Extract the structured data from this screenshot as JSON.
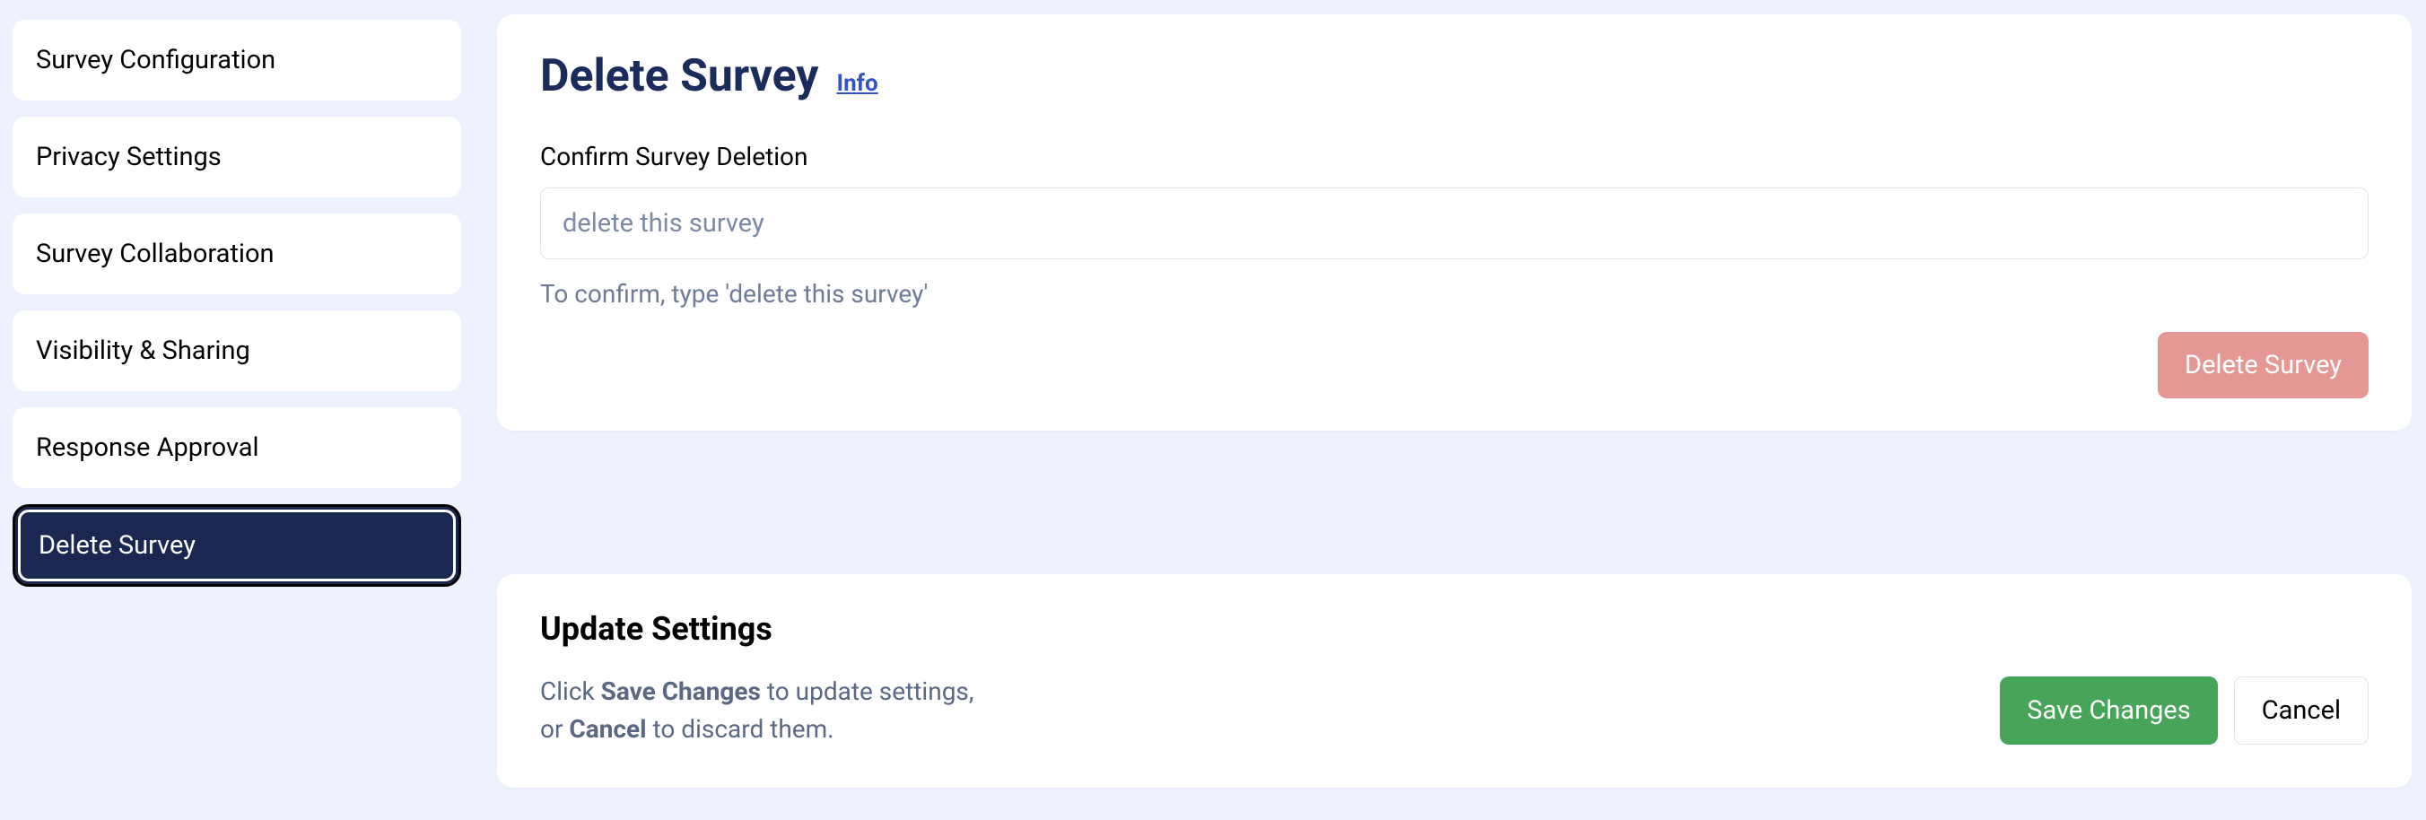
{
  "sidebar": {
    "items": [
      {
        "label": "Survey Configuration",
        "active": false
      },
      {
        "label": "Privacy Settings",
        "active": false
      },
      {
        "label": "Survey Collaboration",
        "active": false
      },
      {
        "label": "Visibility & Sharing",
        "active": false
      },
      {
        "label": "Response Approval",
        "active": false
      },
      {
        "label": "Delete Survey",
        "active": true
      }
    ]
  },
  "delete_panel": {
    "title": "Delete Survey",
    "info_link": "Info",
    "field_label": "Confirm Survey Deletion",
    "input_placeholder": "delete this survey",
    "help_text": "To confirm, type 'delete this survey'",
    "button_label": "Delete Survey"
  },
  "update_panel": {
    "title": "Update Settings",
    "text_part1": "Click ",
    "text_bold1": "Save Changes",
    "text_part2": " to update settings,",
    "text_part3": "or ",
    "text_bold2": "Cancel",
    "text_part4": " to discard them.",
    "save_label": "Save Changes",
    "cancel_label": "Cancel"
  }
}
